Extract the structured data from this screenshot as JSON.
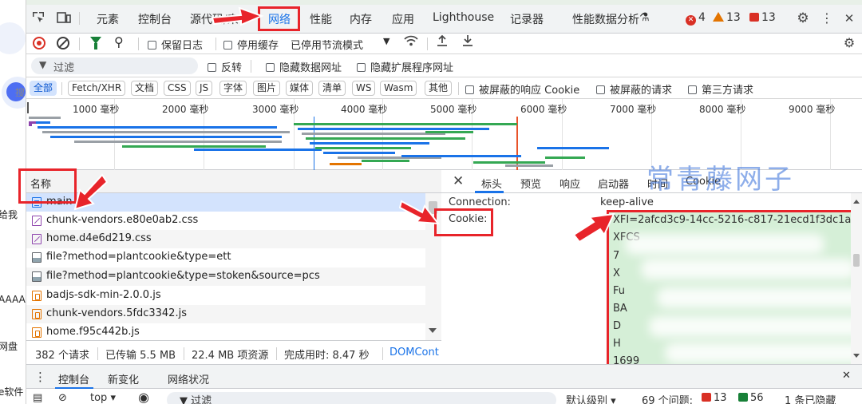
{
  "page_strip": {
    "texts": [
      "给我",
      "搜",
      "AAAA",
      "网盘",
      "e软件"
    ]
  },
  "tabs": [
    "元素",
    "控制台",
    "源代码/来",
    "网络",
    "性能",
    "内存",
    "应用",
    "Lighthouse",
    "记录器",
    "性能数据分析"
  ],
  "active_tab": "网络",
  "badges": {
    "errors": "4",
    "warnings": "13",
    "info": "13"
  },
  "toolbar": {
    "preserve_log": "保留日志",
    "disable_cache": "停用缓存",
    "throttle": "已停用节流模式"
  },
  "filter": {
    "placeholder": "过滤",
    "invert": "反转",
    "hide_data_urls": "隐藏数据网址",
    "hide_ext_urls": "隐藏扩展程序网址"
  },
  "type_filters": [
    "全部",
    "Fetch/XHR",
    "文档",
    "CSS",
    "JS",
    "字体",
    "图片",
    "媒体",
    "清单",
    "WS",
    "Wasm",
    "其他"
  ],
  "type_checks": {
    "blocked_cookie": "被屏蔽的响应 Cookie",
    "blocked_req": "被屏蔽的请求",
    "third_party": "第三方请求"
  },
  "overview": {
    "ticks": [
      "1000 毫秒",
      "2000 毫秒",
      "3000 毫秒",
      "4000 毫秒",
      "5000 毫秒",
      "6000 毫秒",
      "7000 毫秒",
      "8000 毫秒",
      "9000 毫秒"
    ]
  },
  "request_list": {
    "header": "名称",
    "rows": [
      {
        "name": "main",
        "type": "doc"
      },
      {
        "name": "chunk-vendors.e80e0ab2.css",
        "type": "css"
      },
      {
        "name": "home.d4e6d219.css",
        "type": "css"
      },
      {
        "name": "file?method=plantcookie&type=ett",
        "type": "img"
      },
      {
        "name": "file?method=plantcookie&type=stoken&source=pcs",
        "type": "img"
      },
      {
        "name": "badjs-sdk-min-2.0.0.js",
        "type": "js"
      },
      {
        "name": "chunk-vendors.5fdc3342.js",
        "type": "js"
      },
      {
        "name": "home.f95c442b.js",
        "type": "js"
      }
    ]
  },
  "status": {
    "requests": "382 个请求",
    "transferred": "已传输 5.5 MB",
    "resources": "22.4 MB 项资源",
    "finish": "完成用时: 8.47 秒",
    "domcontent": "DOMCont"
  },
  "detail": {
    "tabs": [
      "标头",
      "预览",
      "响应",
      "启动器",
      "时间",
      "Cookie"
    ],
    "connection_label": "Connection:",
    "connection_value": "keep-alive",
    "cookie_label": "Cookie:",
    "cookie_lines": [
      "XFI=2afcd3c9-14cc-5216-c817-21ecd1f3dc1a;",
      "XFCS",
      "7",
      "X",
      "Fu",
      "BA",
      "D",
      "H",
      "1699"
    ]
  },
  "watermark": "常青藤网子",
  "drawer": {
    "tabs": [
      "控制台",
      "新变化",
      "网络状况"
    ],
    "context": "top",
    "filter": "过滤",
    "level": "默认级别",
    "issues": "69 个问题:",
    "issue_errors": "13",
    "issue_info": "56",
    "hidden": "1 条已隐藏"
  }
}
